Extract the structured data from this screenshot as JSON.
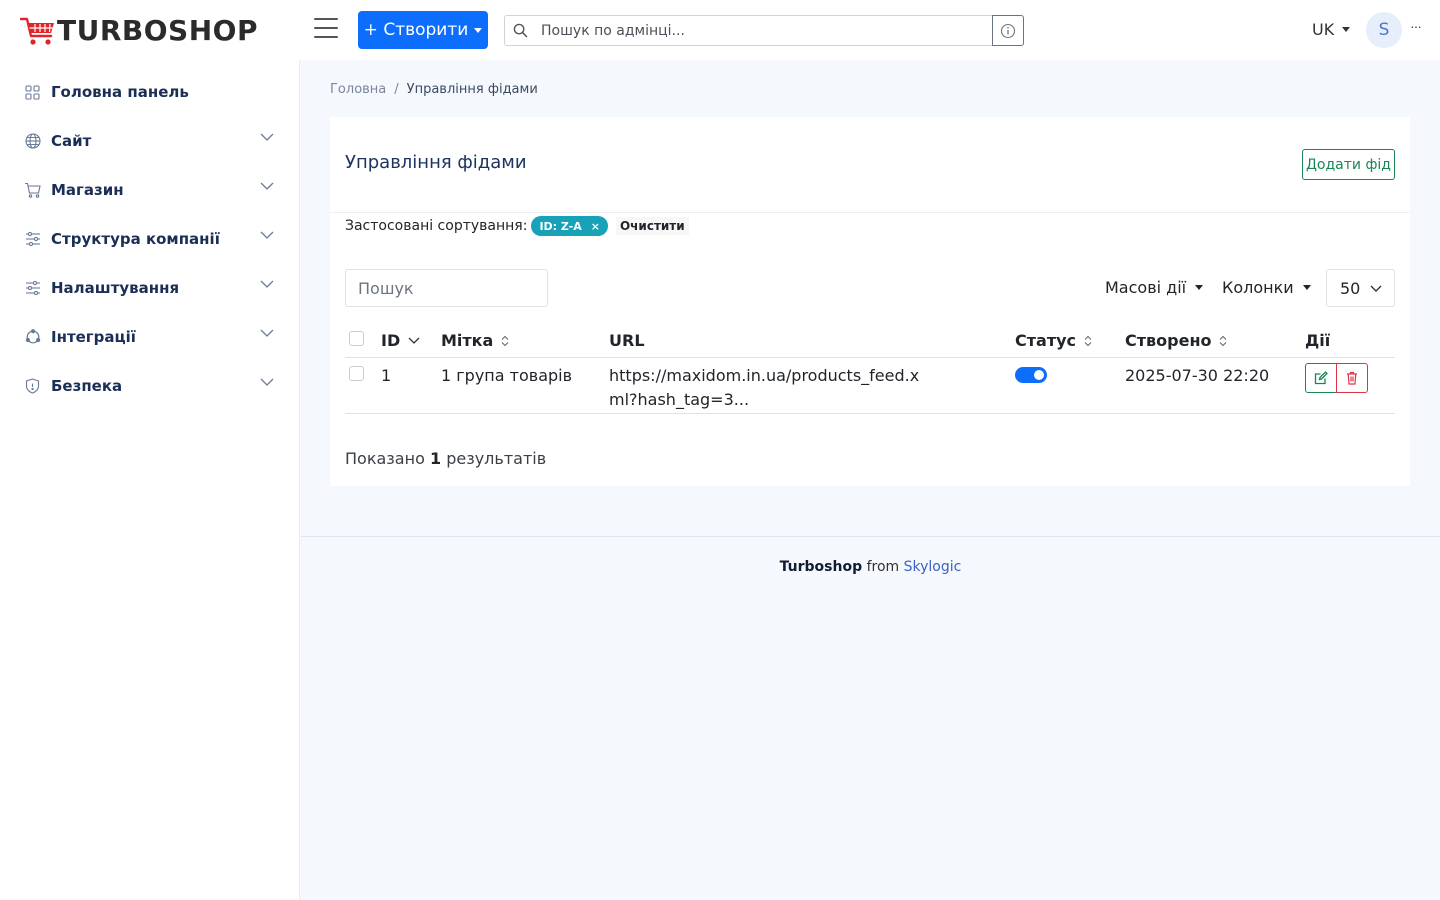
{
  "header": {
    "logo_text": "TURBOSHOP",
    "create_label": "+ Створити",
    "search_placeholder": "Пошук по адмінці...",
    "lang": "UK",
    "avatar_initial": "S",
    "more_label": "···"
  },
  "sidebar": {
    "items": [
      {
        "label": "Головна панель",
        "icon": "grid-icon"
      },
      {
        "label": "Сайт",
        "icon": "globe-icon"
      },
      {
        "label": "Магазин",
        "icon": "cart-icon"
      },
      {
        "label": "Структура компанії",
        "icon": "sliders-icon"
      },
      {
        "label": "Налаштування",
        "icon": "settings-sliders-icon"
      },
      {
        "label": "Інтеграції",
        "icon": "integrations-icon"
      },
      {
        "label": "Безпека",
        "icon": "shield-icon"
      }
    ]
  },
  "breadcrumb": {
    "home": "Головна",
    "separator": "/",
    "current": "Управління фідами"
  },
  "card": {
    "title": "Управління фідами",
    "add_button": "Додати фід",
    "applied_sorts_label": "Застосовані сортування:",
    "sort_badge": "ID: Z-A",
    "sort_badge_close": "×",
    "clear_label": "Очистити",
    "search_placeholder": "Пошук",
    "bulk_actions": "Масові дії",
    "columns": "Колонки",
    "per_page": "50"
  },
  "table": {
    "headers": [
      "ID",
      "Мітка",
      "URL",
      "Статус",
      "Створено",
      "Дії"
    ],
    "rows": [
      {
        "id": "1",
        "label": "1 група товарів",
        "url_line1": "https://maxidom.in.ua/products_feed.x",
        "url_line2": "ml?hash_tag=3...",
        "status": true,
        "created": "2025-07-30 22:20"
      }
    ]
  },
  "results": {
    "prefix": "Показано",
    "count": "1",
    "suffix": "результатів"
  },
  "footer": {
    "brand": "Turboshop",
    "from": "from",
    "company": "Skylogic"
  },
  "colors": {
    "primary": "#0d6efd",
    "success": "#198754",
    "danger": "#dc3545",
    "info": "#17a2b8",
    "nav_text": "#1b2e55"
  }
}
